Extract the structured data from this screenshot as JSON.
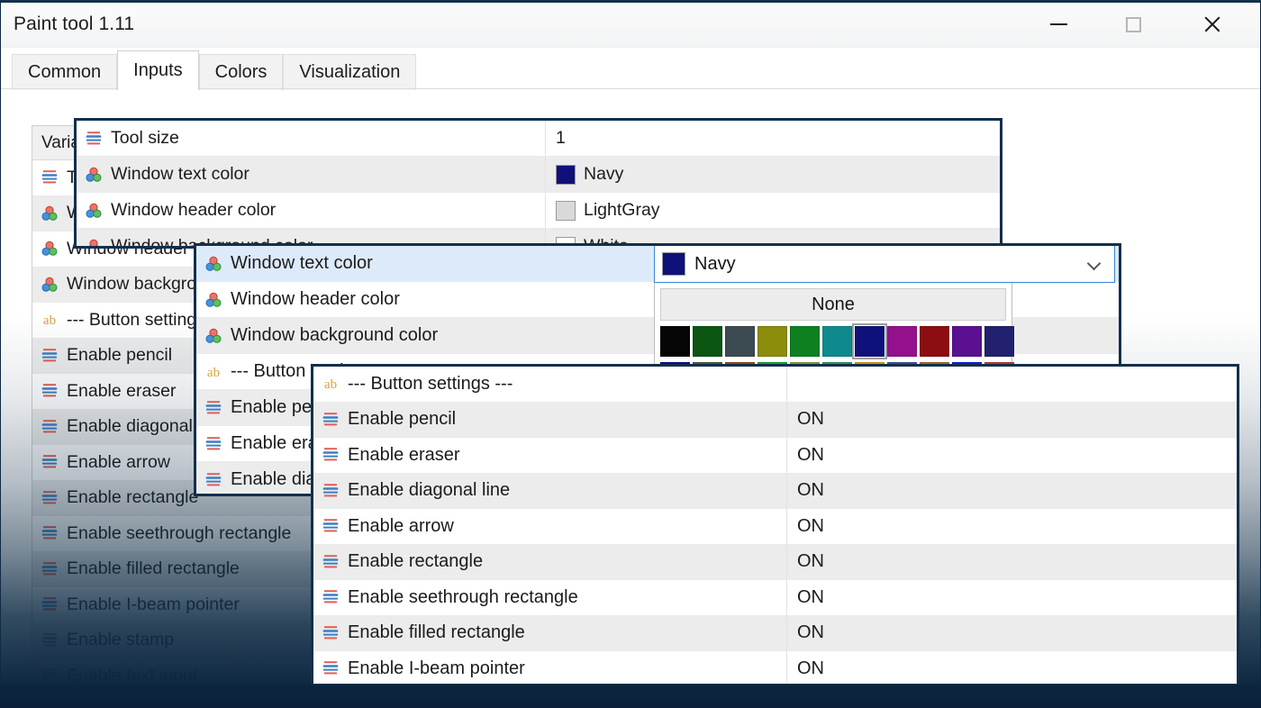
{
  "window": {
    "title": "Paint tool 1.11",
    "controls": [
      {
        "name": "minimize",
        "glyph": "minimize-icon"
      },
      {
        "name": "maximize",
        "glyph": "maximize-icon"
      },
      {
        "name": "close",
        "glyph": "close-icon"
      }
    ]
  },
  "tabs": [
    {
      "label": "Common",
      "selected": false
    },
    {
      "label": "Inputs",
      "selected": true
    },
    {
      "label": "Colors",
      "selected": false
    },
    {
      "label": "Visualization",
      "selected": false
    }
  ],
  "background_panel": {
    "column_header": "Variable",
    "rows": [
      {
        "label": "Tool size",
        "icon": "number-icon"
      },
      {
        "label": "Window text color",
        "icon": "color-icon"
      },
      {
        "label": "Window header color",
        "icon": "color-icon"
      },
      {
        "label": "Window background color",
        "icon": "color-icon"
      },
      {
        "label": "--- Button settings ---",
        "icon": "text-icon"
      },
      {
        "label": "Enable pencil",
        "icon": "bool-icon"
      },
      {
        "label": "Enable eraser",
        "icon": "bool-icon"
      },
      {
        "label": "Enable diagonal line",
        "icon": "bool-icon"
      },
      {
        "label": "Enable arrow",
        "icon": "bool-icon"
      },
      {
        "label": "Enable rectangle",
        "icon": "bool-icon"
      },
      {
        "label": "Enable seethrough rectangle",
        "icon": "bool-icon"
      },
      {
        "label": "Enable filled rectangle",
        "icon": "bool-icon"
      },
      {
        "label": "Enable I-beam pointer",
        "icon": "bool-icon"
      },
      {
        "label": "Enable stamp",
        "icon": "bool-icon"
      },
      {
        "label": "Enable text input",
        "icon": "bool-icon"
      }
    ]
  },
  "popup1": {
    "rows": [
      {
        "label": "Tool size",
        "icon": "number-icon",
        "value": "1",
        "swatch": null,
        "shade": "plain"
      },
      {
        "label": "Window text color",
        "icon": "color-icon",
        "value": "Navy",
        "swatch": "#10107a",
        "shade": "alt"
      },
      {
        "label": "Window header color",
        "icon": "color-icon",
        "value": "LightGray",
        "swatch": "#d9d9d9",
        "shade": "plain"
      },
      {
        "label": "Window background color",
        "icon": "color-icon",
        "value": "White",
        "swatch": "#ffffff",
        "shade": "alt"
      }
    ]
  },
  "popup2": {
    "rows": [
      {
        "label": "Window text color",
        "icon": "color-icon",
        "shade": "sel"
      },
      {
        "label": "Window header color",
        "icon": "color-icon",
        "shade": "plain"
      },
      {
        "label": "Window background color",
        "icon": "color-icon",
        "shade": "alt"
      },
      {
        "label": "--- Button settings ---",
        "icon": "text-icon",
        "shade": "plain"
      },
      {
        "label": "Enable pencil",
        "icon": "bool-icon",
        "shade": "alt"
      },
      {
        "label": "Enable eraser",
        "icon": "bool-icon",
        "shade": "plain"
      },
      {
        "label": "Enable diagonal line",
        "icon": "bool-icon",
        "shade": "alt"
      }
    ],
    "combobox": {
      "value": "Navy",
      "swatch": "#10107a",
      "chevron": "chevron-down-icon",
      "none_label": "None",
      "palette_row1": [
        "#050505",
        "#0b5513",
        "#3c4b51",
        "#8b8b0c",
        "#0d8020",
        "#0e8a8e",
        "#10107a",
        "#95108c",
        "#8c0d12",
        "#5a1090",
        "#21216e"
      ],
      "palette_row2": [
        "#0a0a96",
        "#4a5a3a",
        "#9a4a14",
        "#10a830",
        "#8a9a3a",
        "#2a9a66",
        "#d99a14",
        "#41519a",
        "#a66a2a",
        "#1218ee",
        "#bb3a3a"
      ],
      "picked_index": 6
    }
  },
  "popup3": {
    "rows": [
      {
        "label": "--- Button settings ---",
        "icon": "text-icon",
        "value": "",
        "shade": "plain"
      },
      {
        "label": "Enable pencil",
        "icon": "bool-icon",
        "value": "ON",
        "shade": "alt"
      },
      {
        "label": "Enable eraser",
        "icon": "bool-icon",
        "value": "ON",
        "shade": "plain"
      },
      {
        "label": "Enable diagonal line",
        "icon": "bool-icon",
        "value": "ON",
        "shade": "alt"
      },
      {
        "label": "Enable arrow",
        "icon": "bool-icon",
        "value": "ON",
        "shade": "plain"
      },
      {
        "label": "Enable rectangle",
        "icon": "bool-icon",
        "value": "ON",
        "shade": "alt"
      },
      {
        "label": "Enable seethrough rectangle",
        "icon": "bool-icon",
        "value": "ON",
        "shade": "plain"
      },
      {
        "label": "Enable filled rectangle",
        "icon": "bool-icon",
        "value": "ON",
        "shade": "alt"
      },
      {
        "label": "Enable I-beam pointer",
        "icon": "bool-icon",
        "value": "ON",
        "shade": "plain"
      }
    ]
  },
  "colors": {
    "accent": "#132f4c",
    "selection": "#dceafa",
    "alt_row": "#ececec",
    "desktop": "#0d2740"
  }
}
